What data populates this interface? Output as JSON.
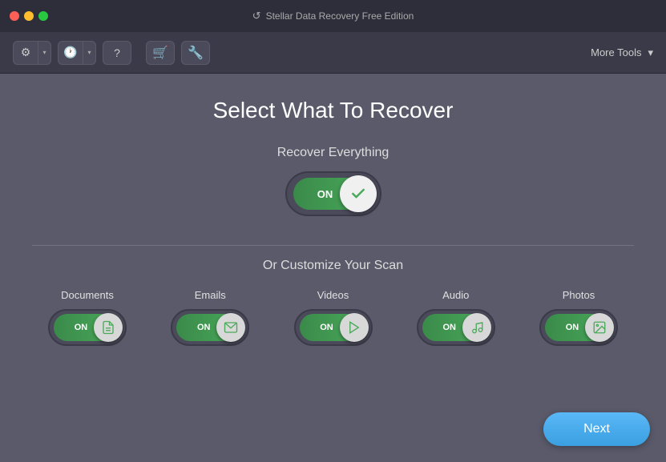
{
  "titlebar": {
    "title": "Stellar Data Recovery Free Edition",
    "icon": "↺"
  },
  "toolbar": {
    "more_tools_label": "More Tools",
    "chevron": "▾"
  },
  "page": {
    "title": "Select What To Recover",
    "recover_everything_label": "Recover Everything",
    "toggle_on_label": "ON",
    "customize_label": "Or Customize Your Scan",
    "categories": [
      {
        "name": "Documents",
        "on_label": "ON",
        "icon": "document"
      },
      {
        "name": "Emails",
        "on_label": "ON",
        "icon": "email"
      },
      {
        "name": "Videos",
        "on_label": "ON",
        "icon": "video"
      },
      {
        "name": "Audio",
        "on_label": "ON",
        "icon": "audio"
      },
      {
        "name": "Photos",
        "on_label": "ON",
        "icon": "photo"
      }
    ]
  },
  "buttons": {
    "next_label": "Next"
  }
}
